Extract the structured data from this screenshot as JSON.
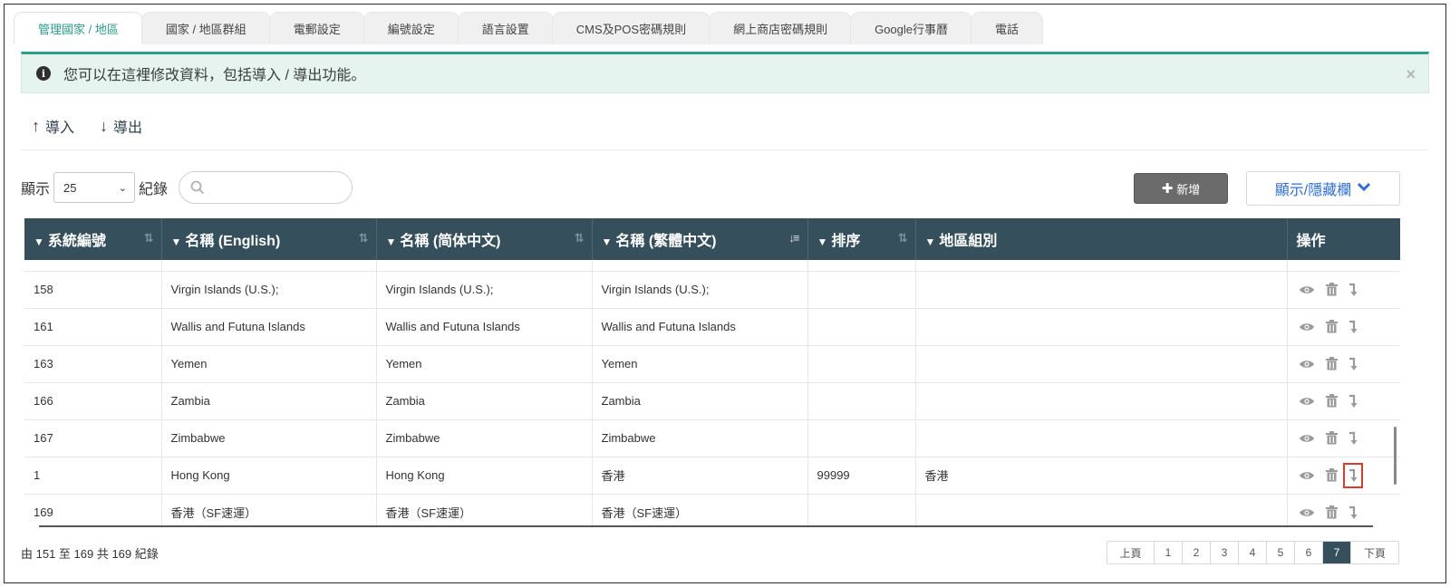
{
  "tabs": [
    {
      "label": "管理國家 / 地區",
      "active": true
    },
    {
      "label": "國家 / 地區群組",
      "active": false
    },
    {
      "label": "電郵設定",
      "active": false
    },
    {
      "label": "編號設定",
      "active": false
    },
    {
      "label": "語言設置",
      "active": false
    },
    {
      "label": "CMS及POS密碼規則",
      "active": false
    },
    {
      "label": "網上商店密碼規則",
      "active": false
    },
    {
      "label": "Google行事曆",
      "active": false
    },
    {
      "label": "電話",
      "active": false
    }
  ],
  "alert": {
    "text": "您可以在這裡修改資料，包括導入 / 導出功能。",
    "close": "×"
  },
  "actions": {
    "import_label": "導入",
    "export_label": "導出"
  },
  "controls": {
    "show_label": "顯示",
    "page_size": "25",
    "records_label": "紀錄",
    "add_label": "新增",
    "toggle_columns_label": "顯示/隱藏欄"
  },
  "table": {
    "headers": [
      {
        "label": "系統編號",
        "sort": "both"
      },
      {
        "label": "名稱 (English)",
        "sort": "both"
      },
      {
        "label": "名稱 (简体中文)",
        "sort": "both"
      },
      {
        "label": "名稱 (繁體中文)",
        "sort": "desc"
      },
      {
        "label": "排序",
        "sort": "both"
      },
      {
        "label": "地區組別",
        "sort": "none"
      },
      {
        "label": "操作",
        "sort": "none"
      }
    ],
    "rows": [
      {
        "id": "158",
        "en": "Virgin Islands (U.S.);",
        "sc": "Virgin Islands (U.S.);",
        "tc": "Virgin Islands (U.S.);",
        "order": "",
        "group": ""
      },
      {
        "id": "161",
        "en": "Wallis and Futuna Islands",
        "sc": "Wallis and Futuna Islands",
        "tc": "Wallis and Futuna Islands",
        "order": "",
        "group": ""
      },
      {
        "id": "163",
        "en": "Yemen",
        "sc": "Yemen",
        "tc": "Yemen",
        "order": "",
        "group": ""
      },
      {
        "id": "166",
        "en": "Zambia",
        "sc": "Zambia",
        "tc": "Zambia",
        "order": "",
        "group": ""
      },
      {
        "id": "167",
        "en": "Zimbabwe",
        "sc": "Zimbabwe",
        "tc": "Zimbabwe",
        "order": "",
        "group": ""
      },
      {
        "id": "1",
        "en": "Hong Kong",
        "sc": "Hong Kong",
        "tc": "香港",
        "order": "99999",
        "group": "香港"
      },
      {
        "id": "169",
        "en": "香港（SF速運）",
        "sc": "香港（SF速運）",
        "tc": "香港（SF速運）",
        "order": "",
        "group": ""
      }
    ]
  },
  "footer": {
    "info": "由 151 至 169 共 169 紀錄",
    "prev": "上頁",
    "pages": [
      "1",
      "2",
      "3",
      "4",
      "5",
      "6",
      "7"
    ],
    "current_page": "7",
    "next": "下頁"
  },
  "icons": {
    "view": "eye-icon",
    "delete": "trash-icon",
    "move": "level-down-icon",
    "filter": "filter-icon"
  },
  "colors": {
    "header_bg": "#354f5c",
    "accent": "#2aa18c",
    "highlight": "#e0382b"
  }
}
